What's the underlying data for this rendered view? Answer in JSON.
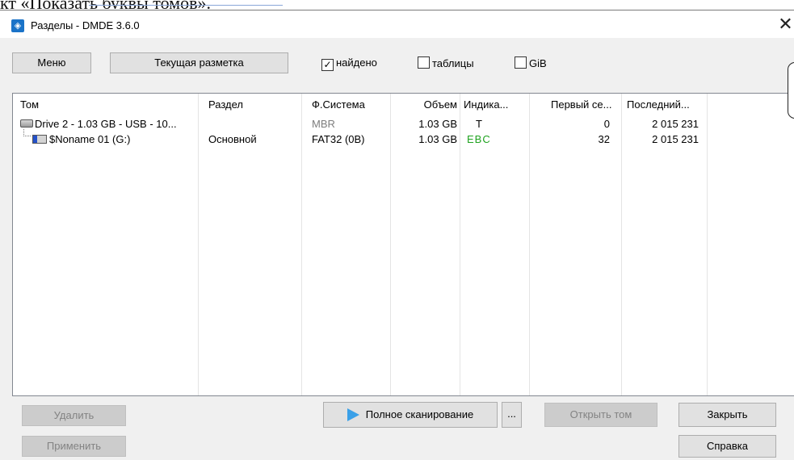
{
  "background_text": "кт «Показать буквы томов».",
  "window": {
    "title": "Разделы - DMDE 3.6.0",
    "close_symbol": "✕"
  },
  "toolbar": {
    "menu_label": "Меню",
    "layout_label": "Текущая разметка",
    "found": {
      "label": "найдено",
      "checked": true
    },
    "tables": {
      "label": "таблицы",
      "checked": false
    },
    "gib": {
      "label": "GiB",
      "checked": false
    }
  },
  "list": {
    "columns": [
      "Том",
      "Раздел",
      "Ф.Система",
      "Объем",
      "Индика...",
      "Первый се...",
      "Последний..."
    ],
    "rows": [
      {
        "volume": "Drive 2 - 1.03 GB - USB - 10...",
        "icon": "drive-icon",
        "partition": "",
        "fs": "MBR",
        "size": "1.03 GB",
        "indicator": "T",
        "first_sector": "0",
        "last_sector": "2 015 231"
      },
      {
        "volume": "$Noname 01 (G:)",
        "icon": "volume-icon",
        "partition": "Основной",
        "fs": "FAT32 (0B)",
        "size": "1.03 GB",
        "indicator": "EBC",
        "first_sector": "32",
        "last_sector": "2 015 231"
      }
    ]
  },
  "buttons": {
    "delete": "Удалить",
    "apply": "Применить",
    "full_scan": "Полное сканирование",
    "more": "...",
    "open_volume": "Открыть том",
    "close": "Закрыть",
    "help": "Справка"
  },
  "colors": {
    "indicator_ok": "#1fa31f",
    "disabled_text": "#838383",
    "scan_icon": "#3aa0e8"
  }
}
